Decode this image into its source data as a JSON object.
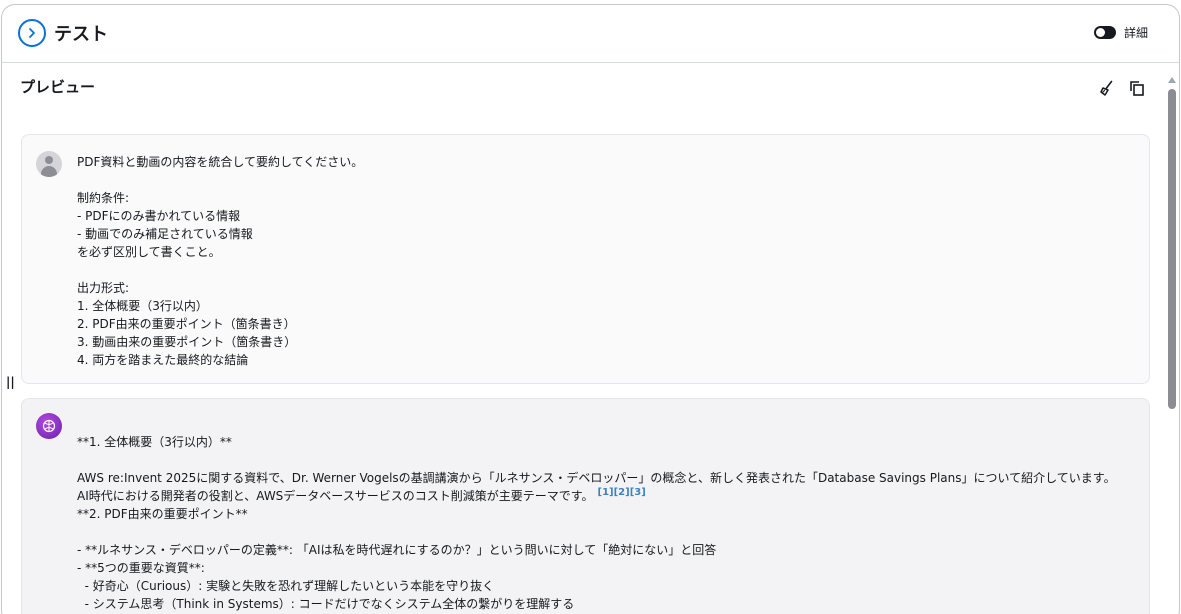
{
  "header": {
    "title": "テスト",
    "toggle_label": "詳細",
    "toggle_on": true
  },
  "preview": {
    "title": "プレビュー",
    "icons": [
      "brush-icon",
      "copy-icon"
    ]
  },
  "user_message": {
    "lines": [
      "PDF資料と動画の内容を統合して要約してください。",
      "",
      "制約条件:",
      "- PDFにのみ書かれている情報",
      "- 動画でのみ補足されている情報",
      "を必ず区別して書くこと。",
      "",
      "出力形式:",
      "1. 全体概要（3行以内）",
      "2. PDF由来の重要ポイント（箇条書き）",
      "3. 動画由来の重要ポイント（箇条書き）",
      "4. 両方を踏まえた最終的な結論"
    ]
  },
  "ai_message": {
    "line1": "**1. 全体概要（3行以内）**",
    "line2": "",
    "line3": "AWS re:Invent 2025に関する資料で、Dr. Werner Vogelsの基調講演から「ルネサンス・デベロッパー」の概念と、新しく発表された「Database Savings Plans」について紹介しています。",
    "line4": "AI時代における開発者の役割と、AWSデータベースサービスのコスト削減策が主要テーマです。",
    "citations": "[1][2][3]",
    "line5": "**2. PDF由来の重要ポイント**",
    "line6": "",
    "line7": "- **ルネサンス・デベロッパーの定義**: 「AIは私を時代遅れにするのか？」という問いに対して「絶対にない」と回答",
    "line8": "- **5つの重要な資質**:",
    "line9": "  - 好奇心（Curious）: 実験と失敗を恐れず理解したいという本能を守り抜く",
    "line10": "  - システム思考（Think in Systems）: コードだけでなくシステム全体の繋がりを理解する"
  },
  "colors": {
    "accent": "#0972d3",
    "ai_avatar": "#8a2bc2",
    "citation": "#3b82c4"
  }
}
